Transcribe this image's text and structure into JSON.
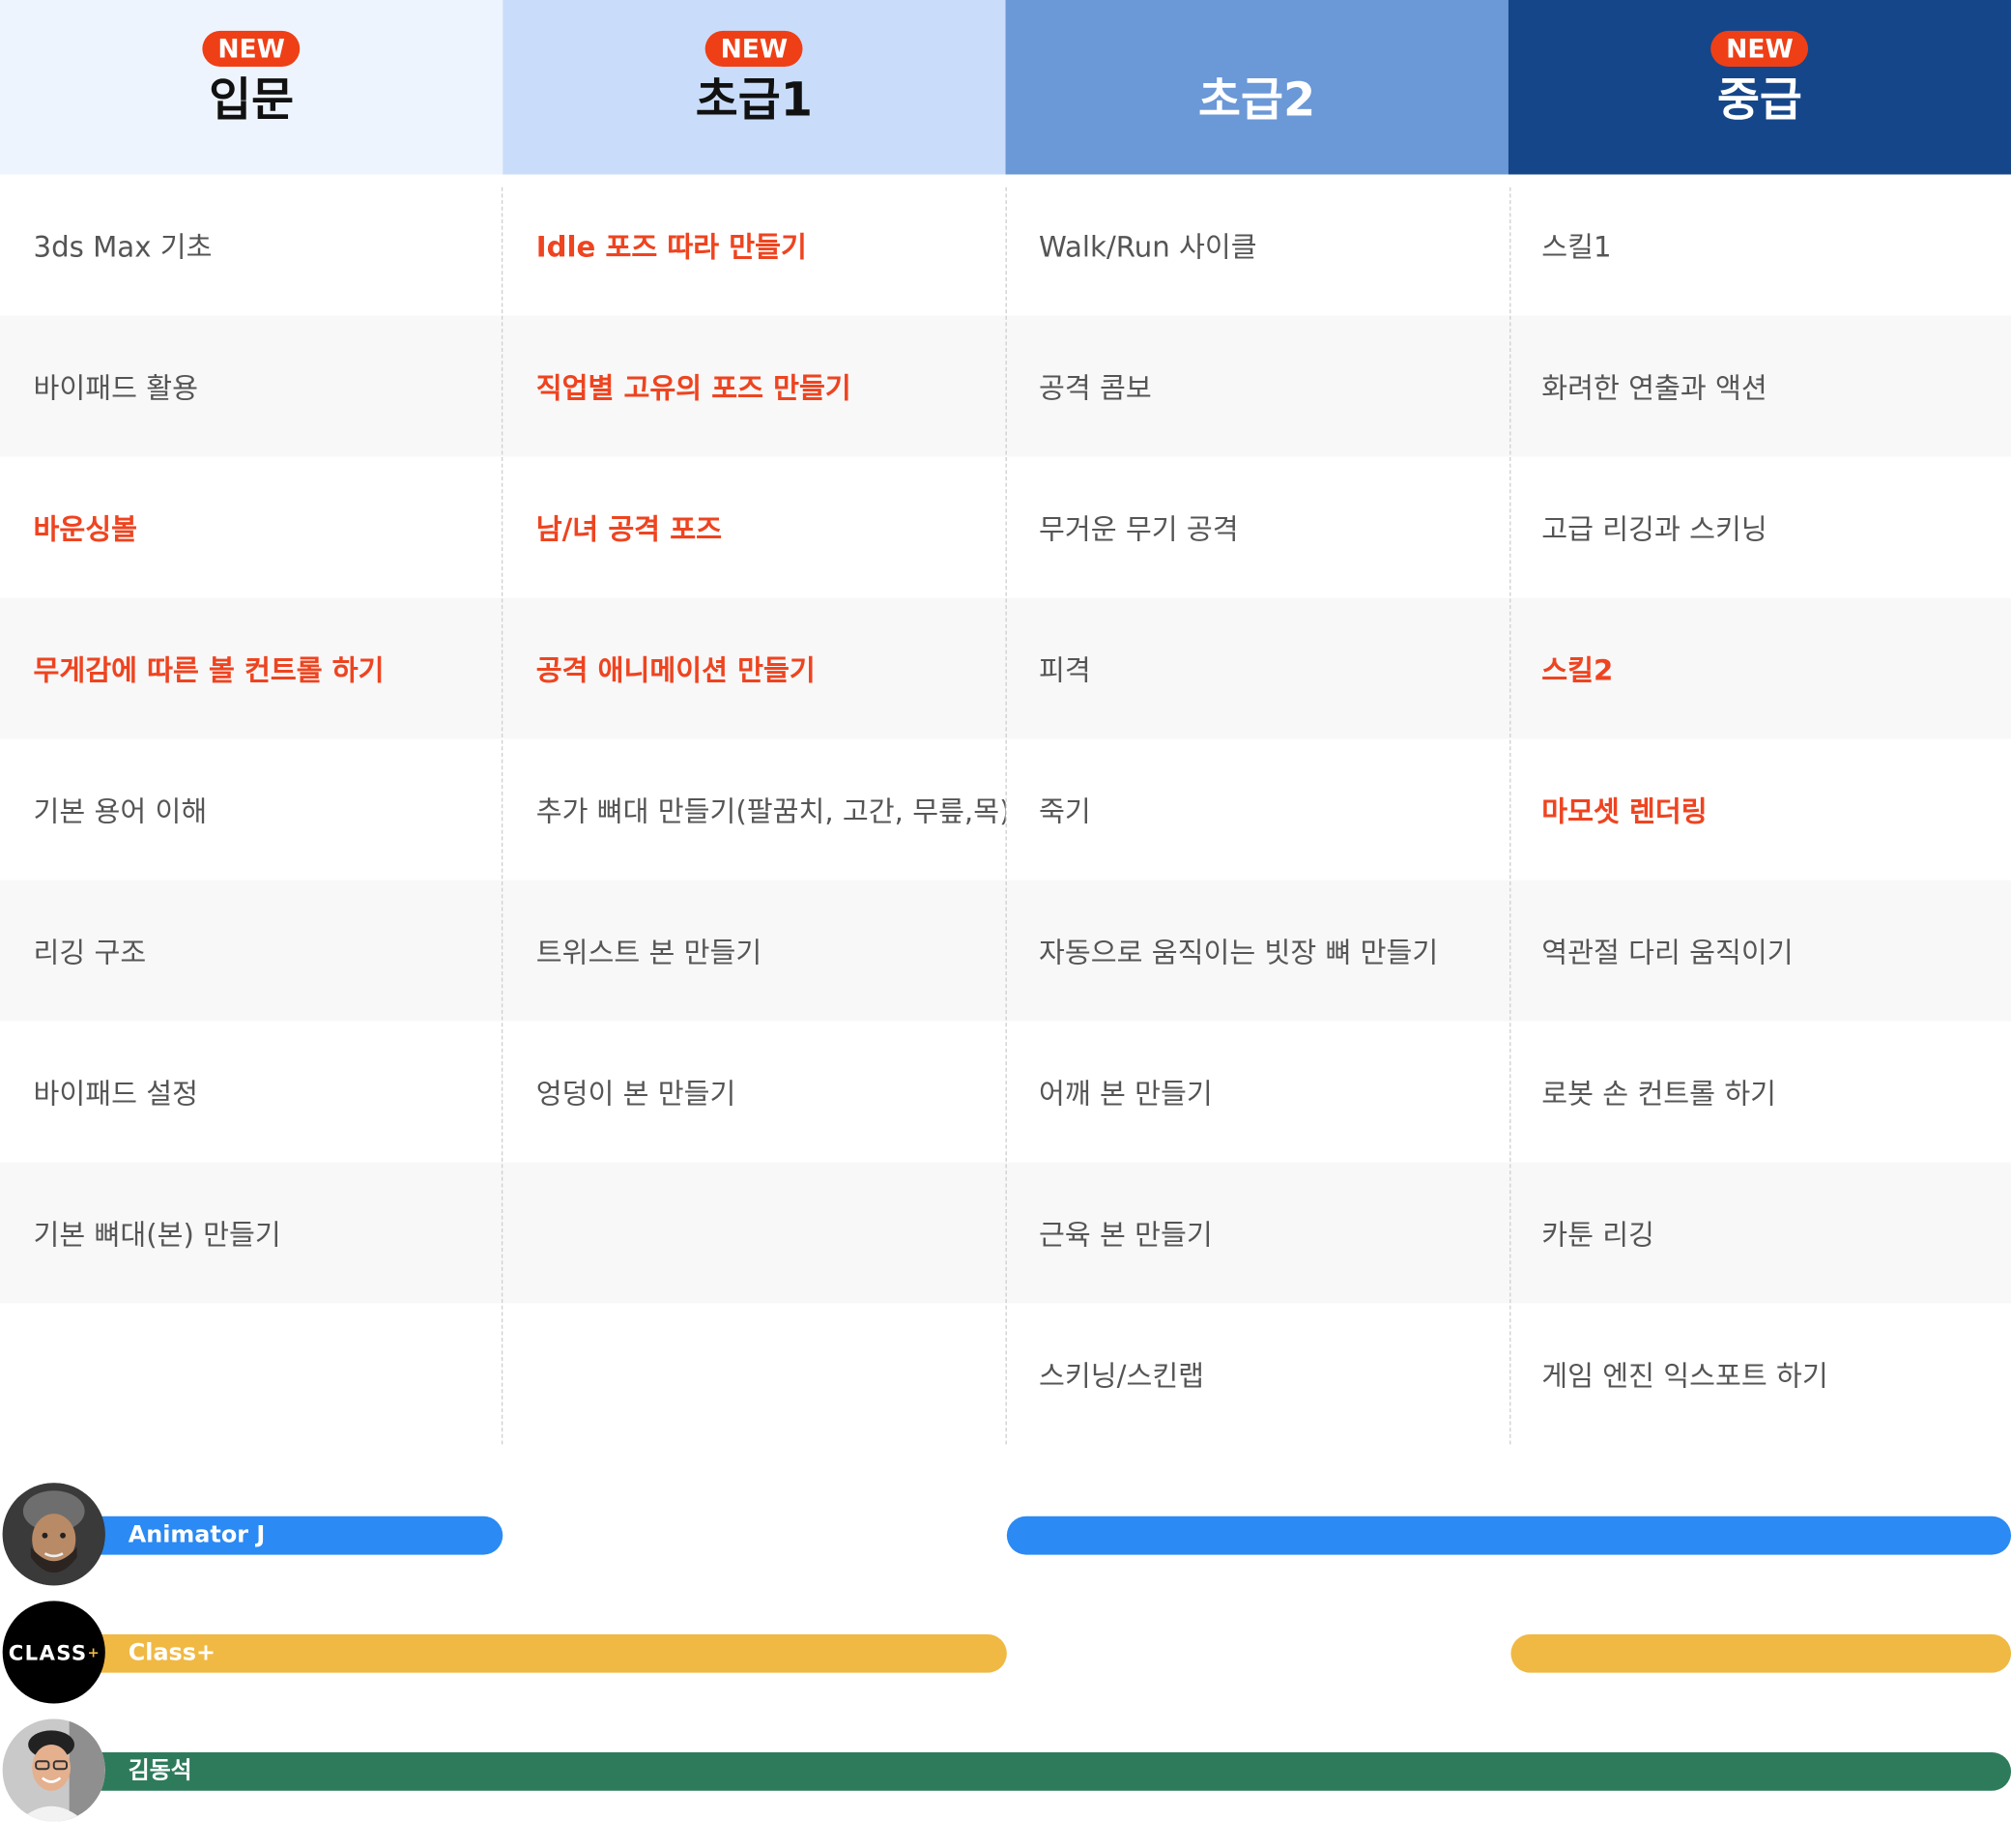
{
  "levels": [
    {
      "title": "입문",
      "badge": "NEW"
    },
    {
      "title": "초급1",
      "badge": "NEW"
    },
    {
      "title": "초급2",
      "badge": ""
    },
    {
      "title": "중급",
      "badge": "NEW"
    }
  ],
  "rows": [
    [
      "3ds Max 기초",
      "Idle 포즈 따라 만들기",
      "Walk/Run 사이클",
      "스킬1"
    ],
    [
      "바이패드 활용",
      "직업별 고유의 포즈 만들기",
      "공격 콤보",
      "화려한 연출과 액션"
    ],
    [
      "바운싱볼",
      "남/녀 공격 포즈",
      "무거운 무기 공격",
      "고급 리깅과 스키닝"
    ],
    [
      "무게감에 따른 볼 컨트롤 하기",
      "공격 애니메이션 만들기",
      "피격",
      "스킬2"
    ],
    [
      "기본 용어 이해",
      "추가 뼈대 만들기(팔꿈치, 고간, 무릎,목)",
      "죽기",
      "마모셋 렌더링"
    ],
    [
      "리깅 구조",
      "트위스트 본 만들기",
      "자동으로 움직이는 빗장 뼈 만들기",
      "역관절 다리 움직이기"
    ],
    [
      "바이패드 설정",
      "엉덩이 본 만들기",
      "어깨 본 만들기",
      "로봇 손 컨트롤 하기"
    ],
    [
      "기본 뼈대(본) 만들기",
      "",
      "근육 본 만들기",
      "카툰 리깅"
    ],
    [
      "",
      "",
      "스키닝/스킨랩",
      "게임 엔진 익스포트 하기"
    ]
  ],
  "highlights": [
    [
      false,
      true,
      false,
      false
    ],
    [
      false,
      true,
      false,
      false
    ],
    [
      true,
      true,
      false,
      false
    ],
    [
      true,
      true,
      false,
      true
    ],
    [
      false,
      false,
      false,
      true
    ],
    [
      false,
      false,
      false,
      false
    ],
    [
      false,
      false,
      false,
      false
    ],
    [
      false,
      false,
      false,
      false
    ],
    [
      false,
      false,
      false,
      false
    ]
  ],
  "instructors": [
    {
      "name": "Animator J",
      "color": "#2b8af3"
    },
    {
      "name": "Class+",
      "color": "#f0b944",
      "logo_text": "CLASS",
      "logo_sup": "+"
    },
    {
      "name": "김동석",
      "color": "#2e7b5b"
    }
  ],
  "colors": {
    "highlight_text": "#ee4420",
    "badge": "#ef3f16",
    "header_bg": [
      "#eef4fd",
      "#c9ddfa",
      "#6b98d6",
      "#154689"
    ]
  }
}
